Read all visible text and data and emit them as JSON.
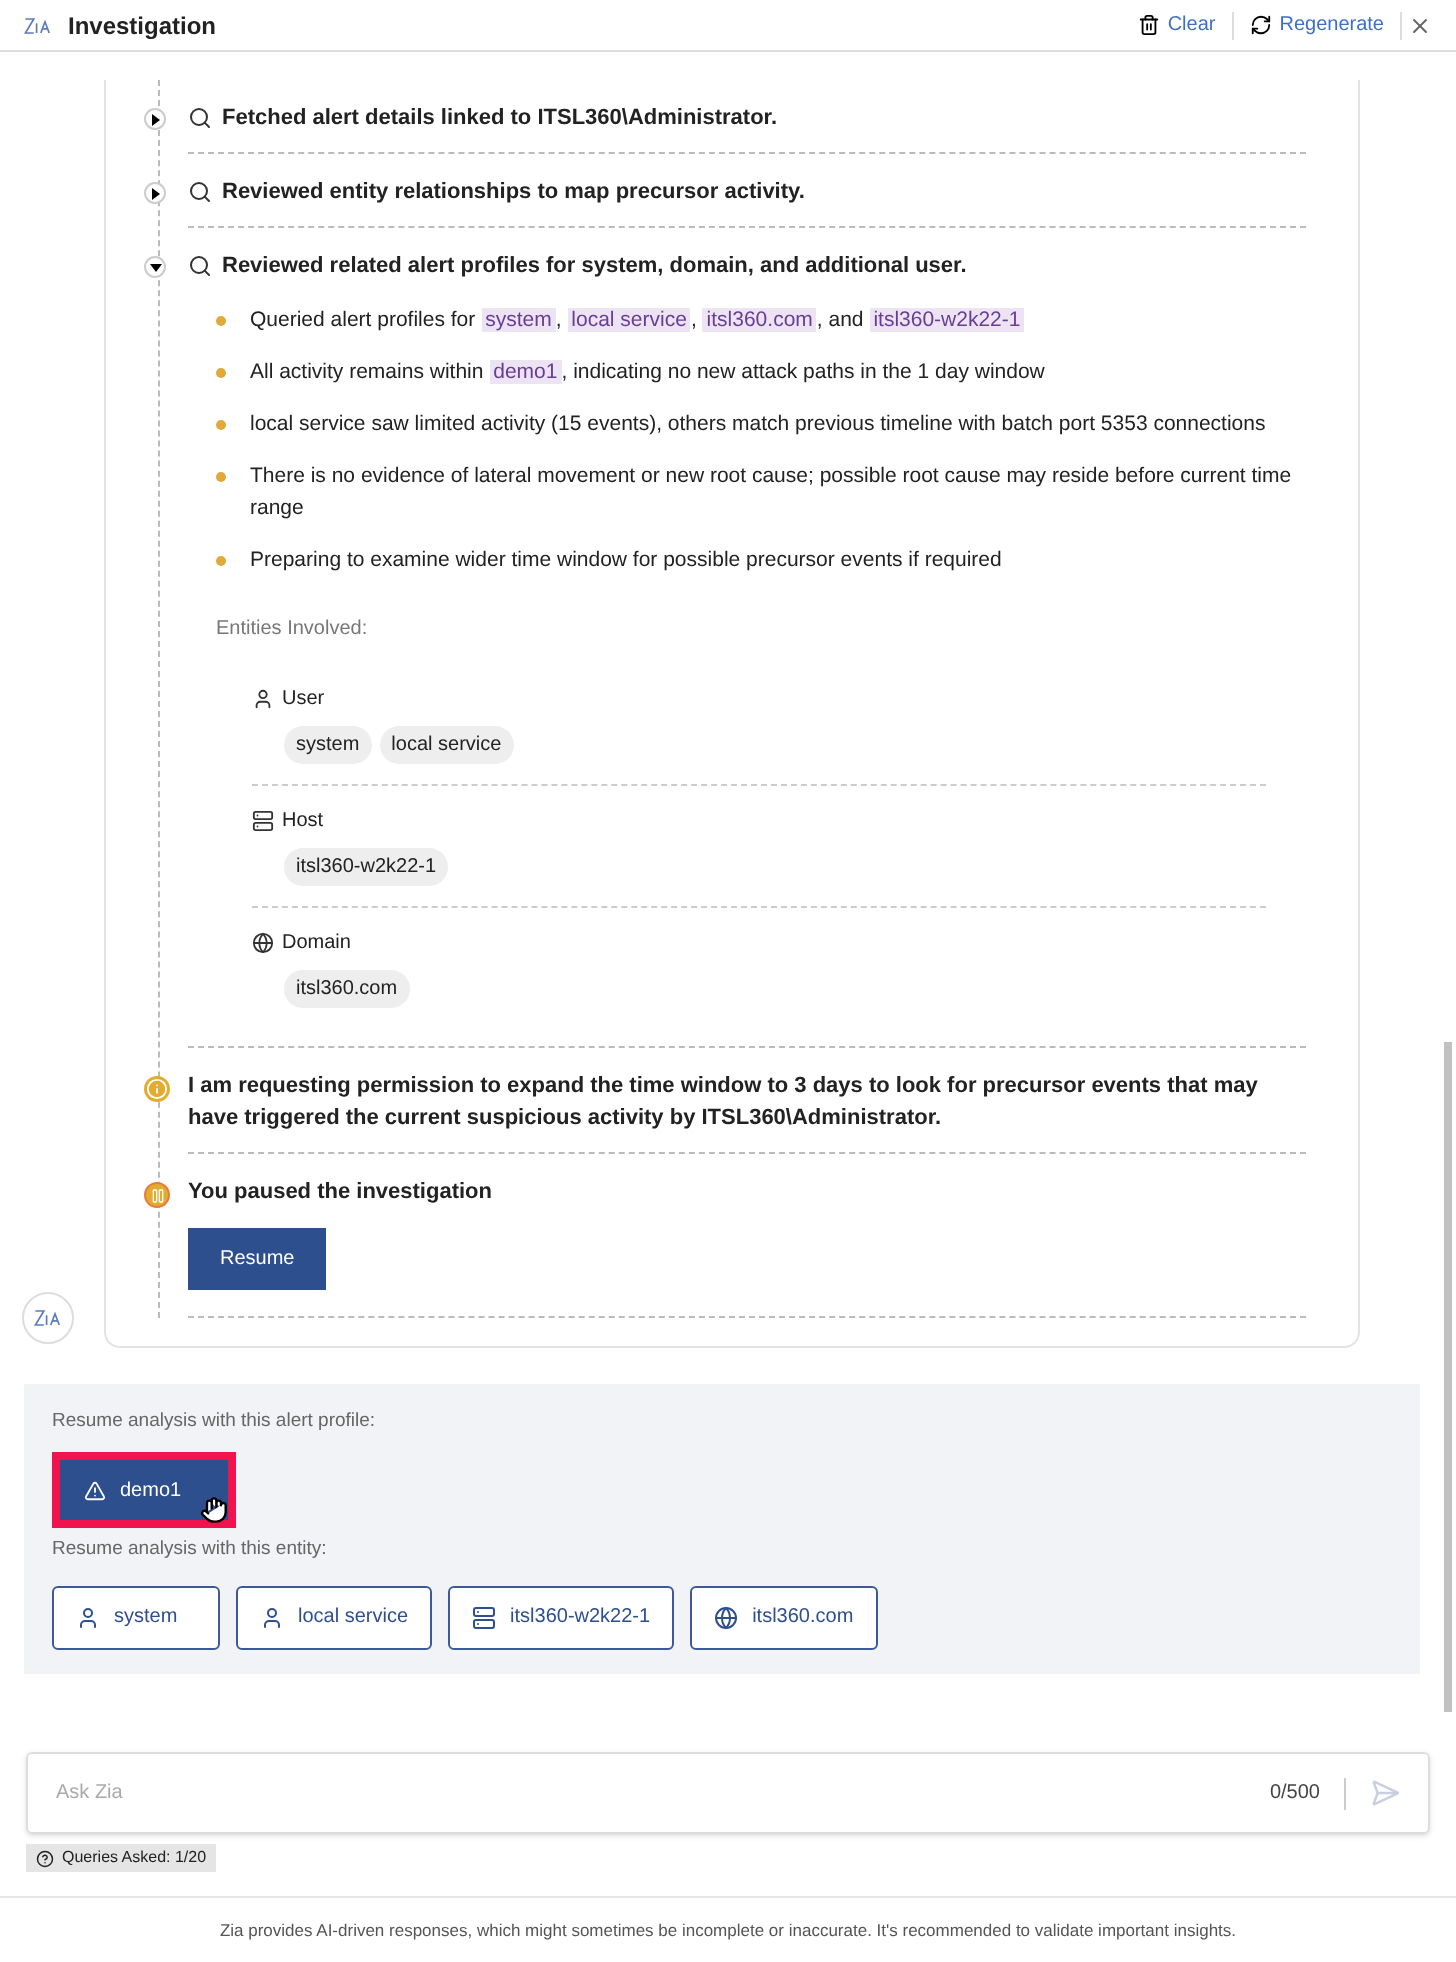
{
  "header": {
    "title": "Investigation",
    "actions": [
      {
        "kind": "clear",
        "label": "Clear"
      },
      {
        "kind": "regenerate",
        "label": "Regenerate"
      }
    ]
  },
  "steps": [
    {
      "kind": "search",
      "text": "Fetched alert details linked to ITSL360\\Administrator.",
      "expanded": false
    },
    {
      "kind": "search",
      "text": "Reviewed entity relationships to map precursor activity.",
      "expanded": false
    },
    {
      "kind": "search",
      "text": "Reviewed related alert profiles for system, domain, and additional user.",
      "expanded": true,
      "bullets": [
        [
          {
            "kind": "text",
            "text": "Queried alert profiles for "
          },
          {
            "kind": "tag",
            "text": "system"
          },
          {
            "kind": "text",
            "text": ", "
          },
          {
            "kind": "tag",
            "text": "local service"
          },
          {
            "kind": "text",
            "text": ", "
          },
          {
            "kind": "tag",
            "text": "itsl360.com"
          },
          {
            "kind": "text",
            "text": ", and "
          },
          {
            "kind": "tag",
            "text": "itsl360-w2k22-1"
          }
        ],
        [
          {
            "kind": "text",
            "text": "All activity remains within "
          },
          {
            "kind": "tag",
            "text": "demo1"
          },
          {
            "kind": "text",
            "text": ", indicating no new attack paths in the 1 day window"
          }
        ],
        [
          {
            "kind": "text",
            "text": "local service saw limited activity (15 events), others match previous timeline with batch port 5353 connections"
          }
        ],
        [
          {
            "kind": "text",
            "text": "There is no evidence of lateral movement or new root cause; possible root cause may reside before current time range"
          }
        ],
        [
          {
            "kind": "text",
            "text": "Preparing to examine wider time window for possible precursor events if required"
          }
        ]
      ],
      "entities_label": "Entities Involved:",
      "entities": [
        {
          "kind": "user",
          "label": "User",
          "values": [
            "system",
            "local service"
          ]
        },
        {
          "kind": "host",
          "label": "Host",
          "values": [
            "itsl360-w2k22-1"
          ]
        },
        {
          "kind": "domain",
          "label": "Domain",
          "values": [
            "itsl360.com"
          ]
        }
      ]
    },
    {
      "kind": "info",
      "text": "I am requesting permission to expand the time window to 3 days to look for precursor events that may have triggered the current suspicious activity by ITSL360\\Administrator."
    },
    {
      "kind": "paused",
      "text": "You paused the investigation",
      "button": "Resume"
    }
  ],
  "suggestions": {
    "profile_label": "Resume analysis with this alert profile:",
    "profiles": [
      {
        "label": "demo1",
        "highlighted": true
      }
    ],
    "entity_label": "Resume analysis with this entity:",
    "entities": [
      {
        "kind": "user",
        "label": "system"
      },
      {
        "kind": "user",
        "label": "local service"
      },
      {
        "kind": "host",
        "label": "itsl360-w2k22-1"
      },
      {
        "kind": "domain",
        "label": "itsl360.com"
      }
    ]
  },
  "input": {
    "placeholder": "Ask Zia",
    "counter": "0/500"
  },
  "queries": "Queries Asked: 1/20",
  "footer": "Zia provides AI-driven responses, which might sometimes be incomplete or inaccurate. It's recommended to validate important insights."
}
